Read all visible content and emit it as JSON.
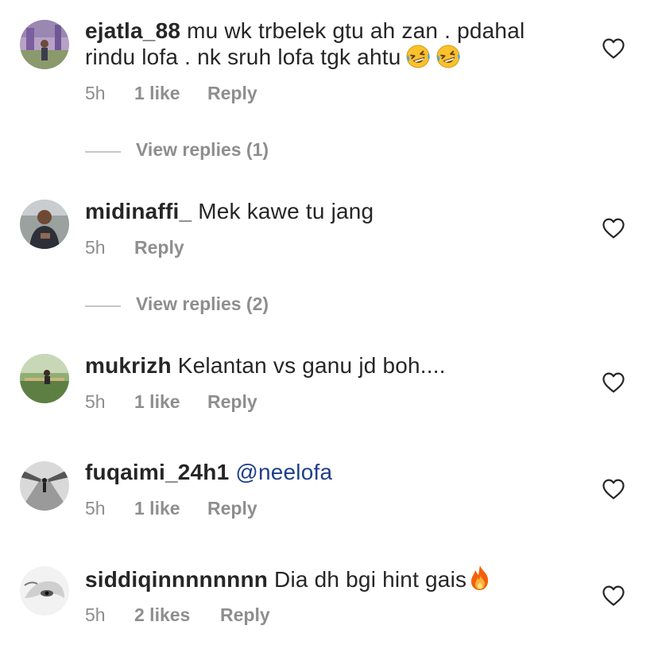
{
  "comments": [
    {
      "username": "ejatla_88",
      "text_line1": "mu wk trbelek gtu ah zan . pdahal",
      "text_line2": "rindu lofa . nk sruh lofa tgk ahtu",
      "emojis": [
        "rolling-on-floor-laughing",
        "rolling-on-floor-laughing"
      ],
      "time": "5h",
      "likes": "1 like",
      "reply": "Reply",
      "view_replies": "View replies (1)"
    },
    {
      "username": "midinaffi_",
      "text": "Mek kawe tu jang",
      "time": "5h",
      "reply": "Reply",
      "view_replies": "View replies (2)"
    },
    {
      "username": "mukrizh",
      "text": "Kelantan vs ganu jd boh....",
      "time": "5h",
      "likes": "1 like",
      "reply": "Reply"
    },
    {
      "username": "fuqaimi_24h1",
      "mention": "@neelofa",
      "time": "5h",
      "likes": "1 like",
      "reply": "Reply"
    },
    {
      "username": "siddiqinnnnnnnn",
      "text": "Dia dh bgi hint gais",
      "emojis": [
        "fire"
      ],
      "time": "5h",
      "likes": "2 likes",
      "reply": "Reply"
    }
  ],
  "colors": {
    "username": "#262626",
    "meta": "#8e8e8e",
    "mention": "#1f3f8a",
    "heart": "#262626"
  }
}
